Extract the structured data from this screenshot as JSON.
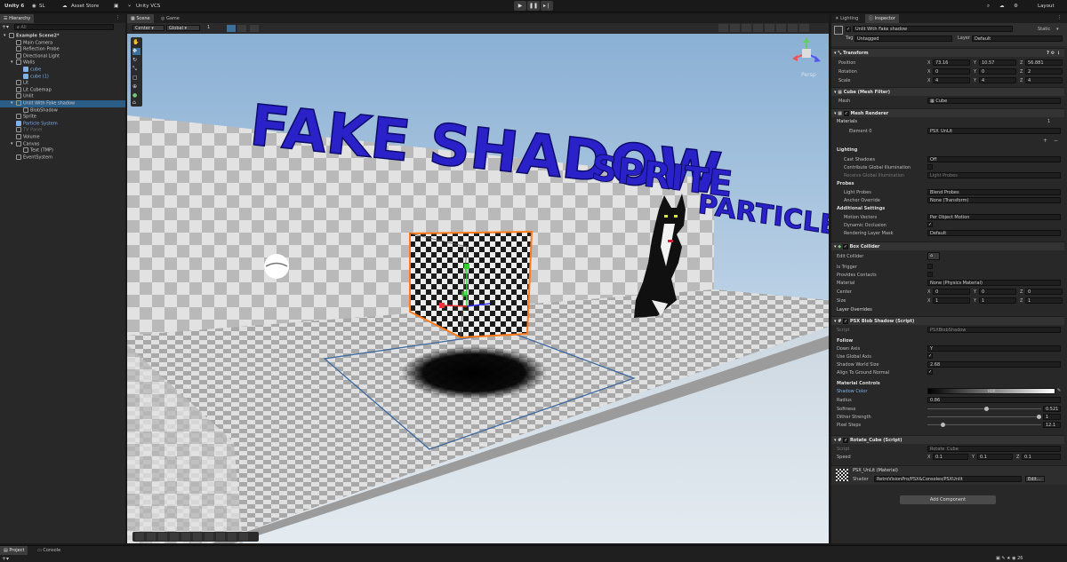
{
  "toolbar": {
    "unity_label": "Unity 6",
    "account_label": "SL",
    "asset_store_label": "Asset Store",
    "vcs_label": "Unity VCS",
    "layout_label": "Layout"
  },
  "hierarchy": {
    "tab_label": "Hierarchy",
    "search_placeholder": "All",
    "items": [
      {
        "label": "Example Scene2*",
        "kind": "scene"
      },
      {
        "label": "Main Camera"
      },
      {
        "label": "Reflection Probe"
      },
      {
        "label": "Directional Light"
      },
      {
        "label": "Walls"
      },
      {
        "label": "cube",
        "kind": "prefab"
      },
      {
        "label": "cube (1)",
        "kind": "prefab"
      },
      {
        "label": "Lit"
      },
      {
        "label": "Lit Cubemap"
      },
      {
        "label": "Unlit"
      },
      {
        "label": "Unlit With Fake shadow",
        "kind": "selected"
      },
      {
        "label": "BlobShadow"
      },
      {
        "label": "Sprite"
      },
      {
        "label": "Particle System",
        "kind": "prefab"
      },
      {
        "label": "TV Panel",
        "kind": "disabled"
      },
      {
        "label": "Volume"
      },
      {
        "label": "Canvas"
      },
      {
        "label": "Text (TMP)"
      },
      {
        "label": "EventSystem"
      }
    ]
  },
  "scene_view": {
    "tabs": [
      "Scene",
      "Game"
    ],
    "pivot_label": "Center",
    "space_label": "Global",
    "grid_value": "1",
    "persp_label": "Persp",
    "signs": [
      "FAKE SHADOW",
      "SPRITE",
      "PARTICLES"
    ]
  },
  "inspector": {
    "tabs": [
      "Lighting",
      "Inspector"
    ],
    "object_name": "Unlit With Fake shadow",
    "static_label": "Static",
    "tag_label": "Tag",
    "tag_value": "Untagged",
    "layer_label": "Layer",
    "layer_value": "Default",
    "transform": {
      "title": "Transform",
      "rows": [
        {
          "label": "Position",
          "x": "73.16",
          "y": "10.57",
          "z": "56.881"
        },
        {
          "label": "Rotation",
          "x": "0",
          "y": "0",
          "z": "2"
        },
        {
          "label": "Scale",
          "x": "4",
          "y": "4",
          "z": "4"
        }
      ]
    },
    "mesh_filter": {
      "title": "Cube (Mesh Filter)",
      "mesh_label": "Mesh",
      "mesh_value": "Cube"
    },
    "mesh_renderer": {
      "title": "Mesh Renderer",
      "materials_label": "Materials",
      "materials_count": "1",
      "element_label": "Element 0",
      "element_value": "PSX_UnLit",
      "lighting_label": "Lighting",
      "cast_shadows_label": "Cast Shadows",
      "cast_shadows_value": "Off",
      "contribute_gi_label": "Contribute Global Illumination",
      "receive_gi_label": "Receive Global Illumination",
      "receive_gi_value": "Light Probes",
      "probes_label": "Probes",
      "light_probes_label": "Light Probes",
      "light_probes_value": "Blend Probes",
      "anchor_label": "Anchor Override",
      "anchor_value": "None (Transform)",
      "additional_label": "Additional Settings",
      "motion_label": "Motion Vectors",
      "motion_value": "Per Object Motion",
      "dynamic_label": "Dynamic Occlusion",
      "rendering_layer_label": "Rendering Layer Mask",
      "rendering_layer_value": "Default"
    },
    "box_collider": {
      "title": "Box Collider",
      "edit_label": "Edit Collider",
      "trigger_label": "Is Trigger",
      "contacts_label": "Provides Contacts",
      "material_label": "Material",
      "material_value": "None (Physics Material)",
      "center_label": "Center",
      "center": {
        "x": "0",
        "y": "0",
        "z": "0"
      },
      "size_label": "Size",
      "size": {
        "x": "1",
        "y": "1",
        "z": "1"
      },
      "overrides_label": "Layer Overrides"
    },
    "psx_blob": {
      "title": "PSX Blob Shadow (Script)",
      "script_label": "Script",
      "script_value": "PSXBlobShadow",
      "follow_label": "Follow",
      "down_axis_label": "Down Axis",
      "down_axis_value": "Y",
      "global_axis_label": "Use Global Axis",
      "world_size_label": "Shadow World Size",
      "world_size_value": "2.68",
      "align_label": "Align To Ground Normal",
      "material_controls_label": "Material Controls",
      "shadow_color_label": "Shadow Color",
      "hdr_label": "HDR",
      "radius_label": "Radius",
      "radius_value": "0.86",
      "softness_label": "Softness",
      "softness_value": "0.521",
      "dither_label": "Dither Strength",
      "dither_value": "1",
      "pixel_steps_label": "Pixel Steps",
      "pixel_steps_value": "12.1"
    },
    "rotate_cube": {
      "title": "Rotate_Cube (Script)",
      "script_label": "Script",
      "script_value": "Rotate_Cube",
      "speed_label": "Speed",
      "speed": {
        "x": "0.1",
        "y": "0.1",
        "z": "0.1"
      }
    },
    "material": {
      "title": "PSX_UnLit (Material)",
      "shader_label": "Shader",
      "shader_value": "RetroVisionPro/PSX&Consoles/PSXUnlit",
      "edit_label": "Edit..."
    },
    "add_component_label": "Add Component"
  },
  "bottom": {
    "tabs": [
      "Project",
      "Console"
    ]
  },
  "colors": {
    "selection": "#2c5d87",
    "accent_blue": "#2f6fb5",
    "sign_blue": "#2a22c8",
    "prefab_blue": "#7fb2ea"
  }
}
